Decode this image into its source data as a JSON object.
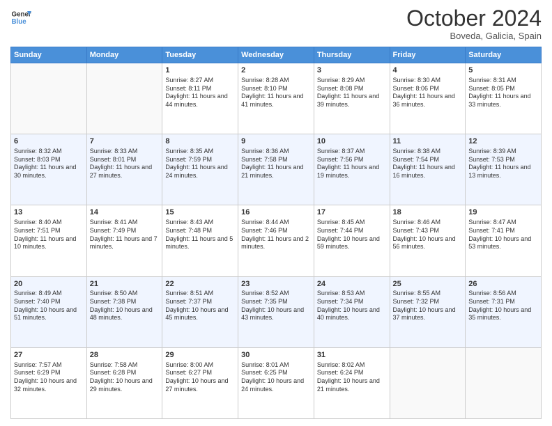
{
  "logo": {
    "line1": "General",
    "line2": "Blue"
  },
  "title": "October 2024",
  "location": "Boveda, Galicia, Spain",
  "days_of_week": [
    "Sunday",
    "Monday",
    "Tuesday",
    "Wednesday",
    "Thursday",
    "Friday",
    "Saturday"
  ],
  "weeks": [
    [
      {
        "day": "",
        "info": ""
      },
      {
        "day": "",
        "info": ""
      },
      {
        "day": "1",
        "info": "Sunrise: 8:27 AM\nSunset: 8:11 PM\nDaylight: 11 hours and 44 minutes."
      },
      {
        "day": "2",
        "info": "Sunrise: 8:28 AM\nSunset: 8:10 PM\nDaylight: 11 hours and 41 minutes."
      },
      {
        "day": "3",
        "info": "Sunrise: 8:29 AM\nSunset: 8:08 PM\nDaylight: 11 hours and 39 minutes."
      },
      {
        "day": "4",
        "info": "Sunrise: 8:30 AM\nSunset: 8:06 PM\nDaylight: 11 hours and 36 minutes."
      },
      {
        "day": "5",
        "info": "Sunrise: 8:31 AM\nSunset: 8:05 PM\nDaylight: 11 hours and 33 minutes."
      }
    ],
    [
      {
        "day": "6",
        "info": "Sunrise: 8:32 AM\nSunset: 8:03 PM\nDaylight: 11 hours and 30 minutes."
      },
      {
        "day": "7",
        "info": "Sunrise: 8:33 AM\nSunset: 8:01 PM\nDaylight: 11 hours and 27 minutes."
      },
      {
        "day": "8",
        "info": "Sunrise: 8:35 AM\nSunset: 7:59 PM\nDaylight: 11 hours and 24 minutes."
      },
      {
        "day": "9",
        "info": "Sunrise: 8:36 AM\nSunset: 7:58 PM\nDaylight: 11 hours and 21 minutes."
      },
      {
        "day": "10",
        "info": "Sunrise: 8:37 AM\nSunset: 7:56 PM\nDaylight: 11 hours and 19 minutes."
      },
      {
        "day": "11",
        "info": "Sunrise: 8:38 AM\nSunset: 7:54 PM\nDaylight: 11 hours and 16 minutes."
      },
      {
        "day": "12",
        "info": "Sunrise: 8:39 AM\nSunset: 7:53 PM\nDaylight: 11 hours and 13 minutes."
      }
    ],
    [
      {
        "day": "13",
        "info": "Sunrise: 8:40 AM\nSunset: 7:51 PM\nDaylight: 11 hours and 10 minutes."
      },
      {
        "day": "14",
        "info": "Sunrise: 8:41 AM\nSunset: 7:49 PM\nDaylight: 11 hours and 7 minutes."
      },
      {
        "day": "15",
        "info": "Sunrise: 8:43 AM\nSunset: 7:48 PM\nDaylight: 11 hours and 5 minutes."
      },
      {
        "day": "16",
        "info": "Sunrise: 8:44 AM\nSunset: 7:46 PM\nDaylight: 11 hours and 2 minutes."
      },
      {
        "day": "17",
        "info": "Sunrise: 8:45 AM\nSunset: 7:44 PM\nDaylight: 10 hours and 59 minutes."
      },
      {
        "day": "18",
        "info": "Sunrise: 8:46 AM\nSunset: 7:43 PM\nDaylight: 10 hours and 56 minutes."
      },
      {
        "day": "19",
        "info": "Sunrise: 8:47 AM\nSunset: 7:41 PM\nDaylight: 10 hours and 53 minutes."
      }
    ],
    [
      {
        "day": "20",
        "info": "Sunrise: 8:49 AM\nSunset: 7:40 PM\nDaylight: 10 hours and 51 minutes."
      },
      {
        "day": "21",
        "info": "Sunrise: 8:50 AM\nSunset: 7:38 PM\nDaylight: 10 hours and 48 minutes."
      },
      {
        "day": "22",
        "info": "Sunrise: 8:51 AM\nSunset: 7:37 PM\nDaylight: 10 hours and 45 minutes."
      },
      {
        "day": "23",
        "info": "Sunrise: 8:52 AM\nSunset: 7:35 PM\nDaylight: 10 hours and 43 minutes."
      },
      {
        "day": "24",
        "info": "Sunrise: 8:53 AM\nSunset: 7:34 PM\nDaylight: 10 hours and 40 minutes."
      },
      {
        "day": "25",
        "info": "Sunrise: 8:55 AM\nSunset: 7:32 PM\nDaylight: 10 hours and 37 minutes."
      },
      {
        "day": "26",
        "info": "Sunrise: 8:56 AM\nSunset: 7:31 PM\nDaylight: 10 hours and 35 minutes."
      }
    ],
    [
      {
        "day": "27",
        "info": "Sunrise: 7:57 AM\nSunset: 6:29 PM\nDaylight: 10 hours and 32 minutes."
      },
      {
        "day": "28",
        "info": "Sunrise: 7:58 AM\nSunset: 6:28 PM\nDaylight: 10 hours and 29 minutes."
      },
      {
        "day": "29",
        "info": "Sunrise: 8:00 AM\nSunset: 6:27 PM\nDaylight: 10 hours and 27 minutes."
      },
      {
        "day": "30",
        "info": "Sunrise: 8:01 AM\nSunset: 6:25 PM\nDaylight: 10 hours and 24 minutes."
      },
      {
        "day": "31",
        "info": "Sunrise: 8:02 AM\nSunset: 6:24 PM\nDaylight: 10 hours and 21 minutes."
      },
      {
        "day": "",
        "info": ""
      },
      {
        "day": "",
        "info": ""
      }
    ]
  ]
}
